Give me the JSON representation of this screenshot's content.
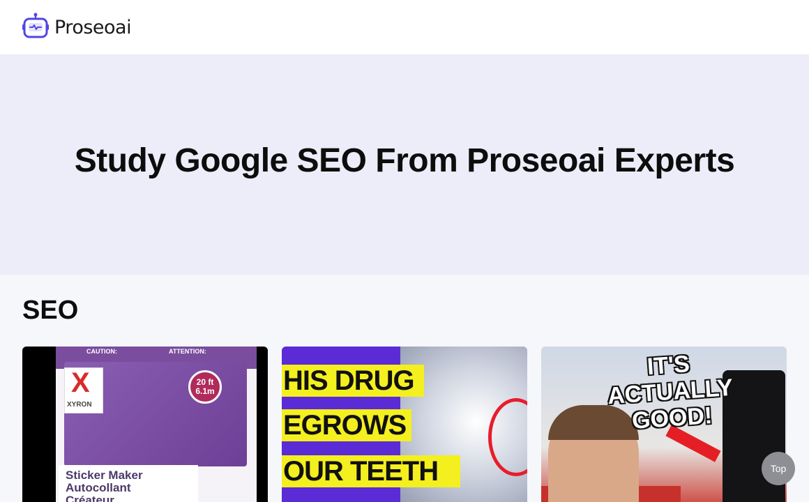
{
  "header": {
    "logo_text": "Proseoai",
    "logo_icon": "robot-icon",
    "accent_color": "#4f46e5"
  },
  "hero": {
    "title": "Study Google SEO From Proseoai Experts"
  },
  "section": {
    "title": "SEO",
    "cards": [
      {
        "thumbnail_text": [
          "Sticker Maker",
          "Autocollant",
          "Créateur"
        ],
        "badge": [
          "20 ft",
          "6.1m"
        ],
        "brand": "XYRON",
        "caution": "CAUTION:",
        "attention": "ATTENTION:"
      },
      {
        "thumbnail_text": [
          "HIS DRUG",
          "EGROWS",
          "OUR TEETH"
        ]
      },
      {
        "thumbnail_text": [
          "IT'S",
          "ACTUALLY",
          "GOOD!"
        ]
      }
    ]
  },
  "top_button": {
    "label": "Top"
  }
}
